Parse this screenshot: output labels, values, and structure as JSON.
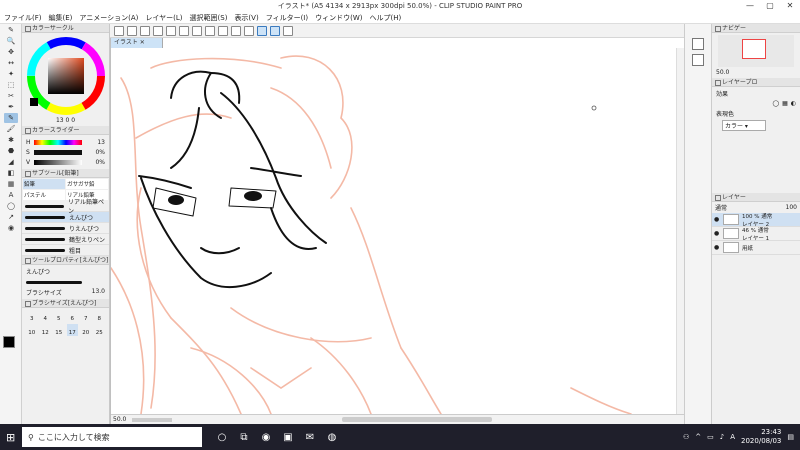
{
  "window": {
    "title": "イラスト* (A5 4134 x 2913px 300dpi 50.0%) - CLIP STUDIO PAINT PRO"
  },
  "menu": [
    "ファイル(F)",
    "編集(E)",
    "アニメーション(A)",
    "レイヤー(L)",
    "選択範囲(S)",
    "表示(V)",
    "フィルター(I)",
    "ウィンドウ(W)",
    "ヘルプ(H)"
  ],
  "tools": [
    "✎",
    "🔍",
    "✥",
    "↔",
    "✦",
    "⬚",
    "✂",
    "✒",
    "✎",
    "🖌",
    "✱",
    "⬣",
    "◢",
    "◧",
    "▦",
    "A",
    "◯",
    "↗",
    "◉"
  ],
  "color_circle": {
    "header": "カラーサークル",
    "readout": "13 0 0"
  },
  "color_slider": {
    "header": "カラースライダー",
    "h_label": "H",
    "h_value": "13",
    "s_label": "S",
    "s_value": "0%",
    "v_label": "V",
    "v_value": "0%"
  },
  "sub_tool": {
    "header": "サブツール[鉛筆]",
    "tabs": [
      "鉛筆",
      "ガサガサ鉛",
      "パステル",
      "リアル鉛筆"
    ],
    "brushes": [
      "リアル鉛筆ペン",
      "えんぴつ",
      "りえんぴつ",
      "鶴型えりペン",
      "粗目"
    ]
  },
  "tool_property": {
    "header": "ツールプロパティ[えんぴつ]",
    "brush_name": "えんぴつ",
    "size_label": "ブラシサイズ",
    "size_value": "13.0"
  },
  "brush_size": {
    "header": "ブラシサイズ[えんぴつ]",
    "sizes": [
      "3",
      "4",
      "5",
      "6",
      "7",
      "8",
      "10",
      "12",
      "15",
      "17",
      "20",
      "25"
    ],
    "selected": "17"
  },
  "canvas": {
    "tab_label": "イラスト",
    "zoom": "50.0"
  },
  "navigator": {
    "header": "ナビゲー",
    "zoom": "50.0"
  },
  "layer_property": {
    "header": "レイヤープロ",
    "effect_label": "効果",
    "display_color_label": "表現色",
    "display_color_value": "カラー"
  },
  "layers": {
    "header": "レイヤー",
    "blend_mode": "通常",
    "opacity": "100",
    "rows": [
      {
        "info": "100 % 通常",
        "name": "レイヤー 2",
        "selected": true
      },
      {
        "info": "46 % 通常",
        "name": "レイヤー 1",
        "selected": false
      },
      {
        "info": "",
        "name": "用紙",
        "selected": false
      }
    ]
  },
  "taskbar": {
    "search_placeholder": "ここに入力して検索",
    "time": "23:43",
    "date": "2020/08/03",
    "ime": "A"
  },
  "colors": {
    "selection": "#9fc3e4",
    "sketch": "#f4b9a6",
    "taskbar": "#1f1f2b"
  }
}
